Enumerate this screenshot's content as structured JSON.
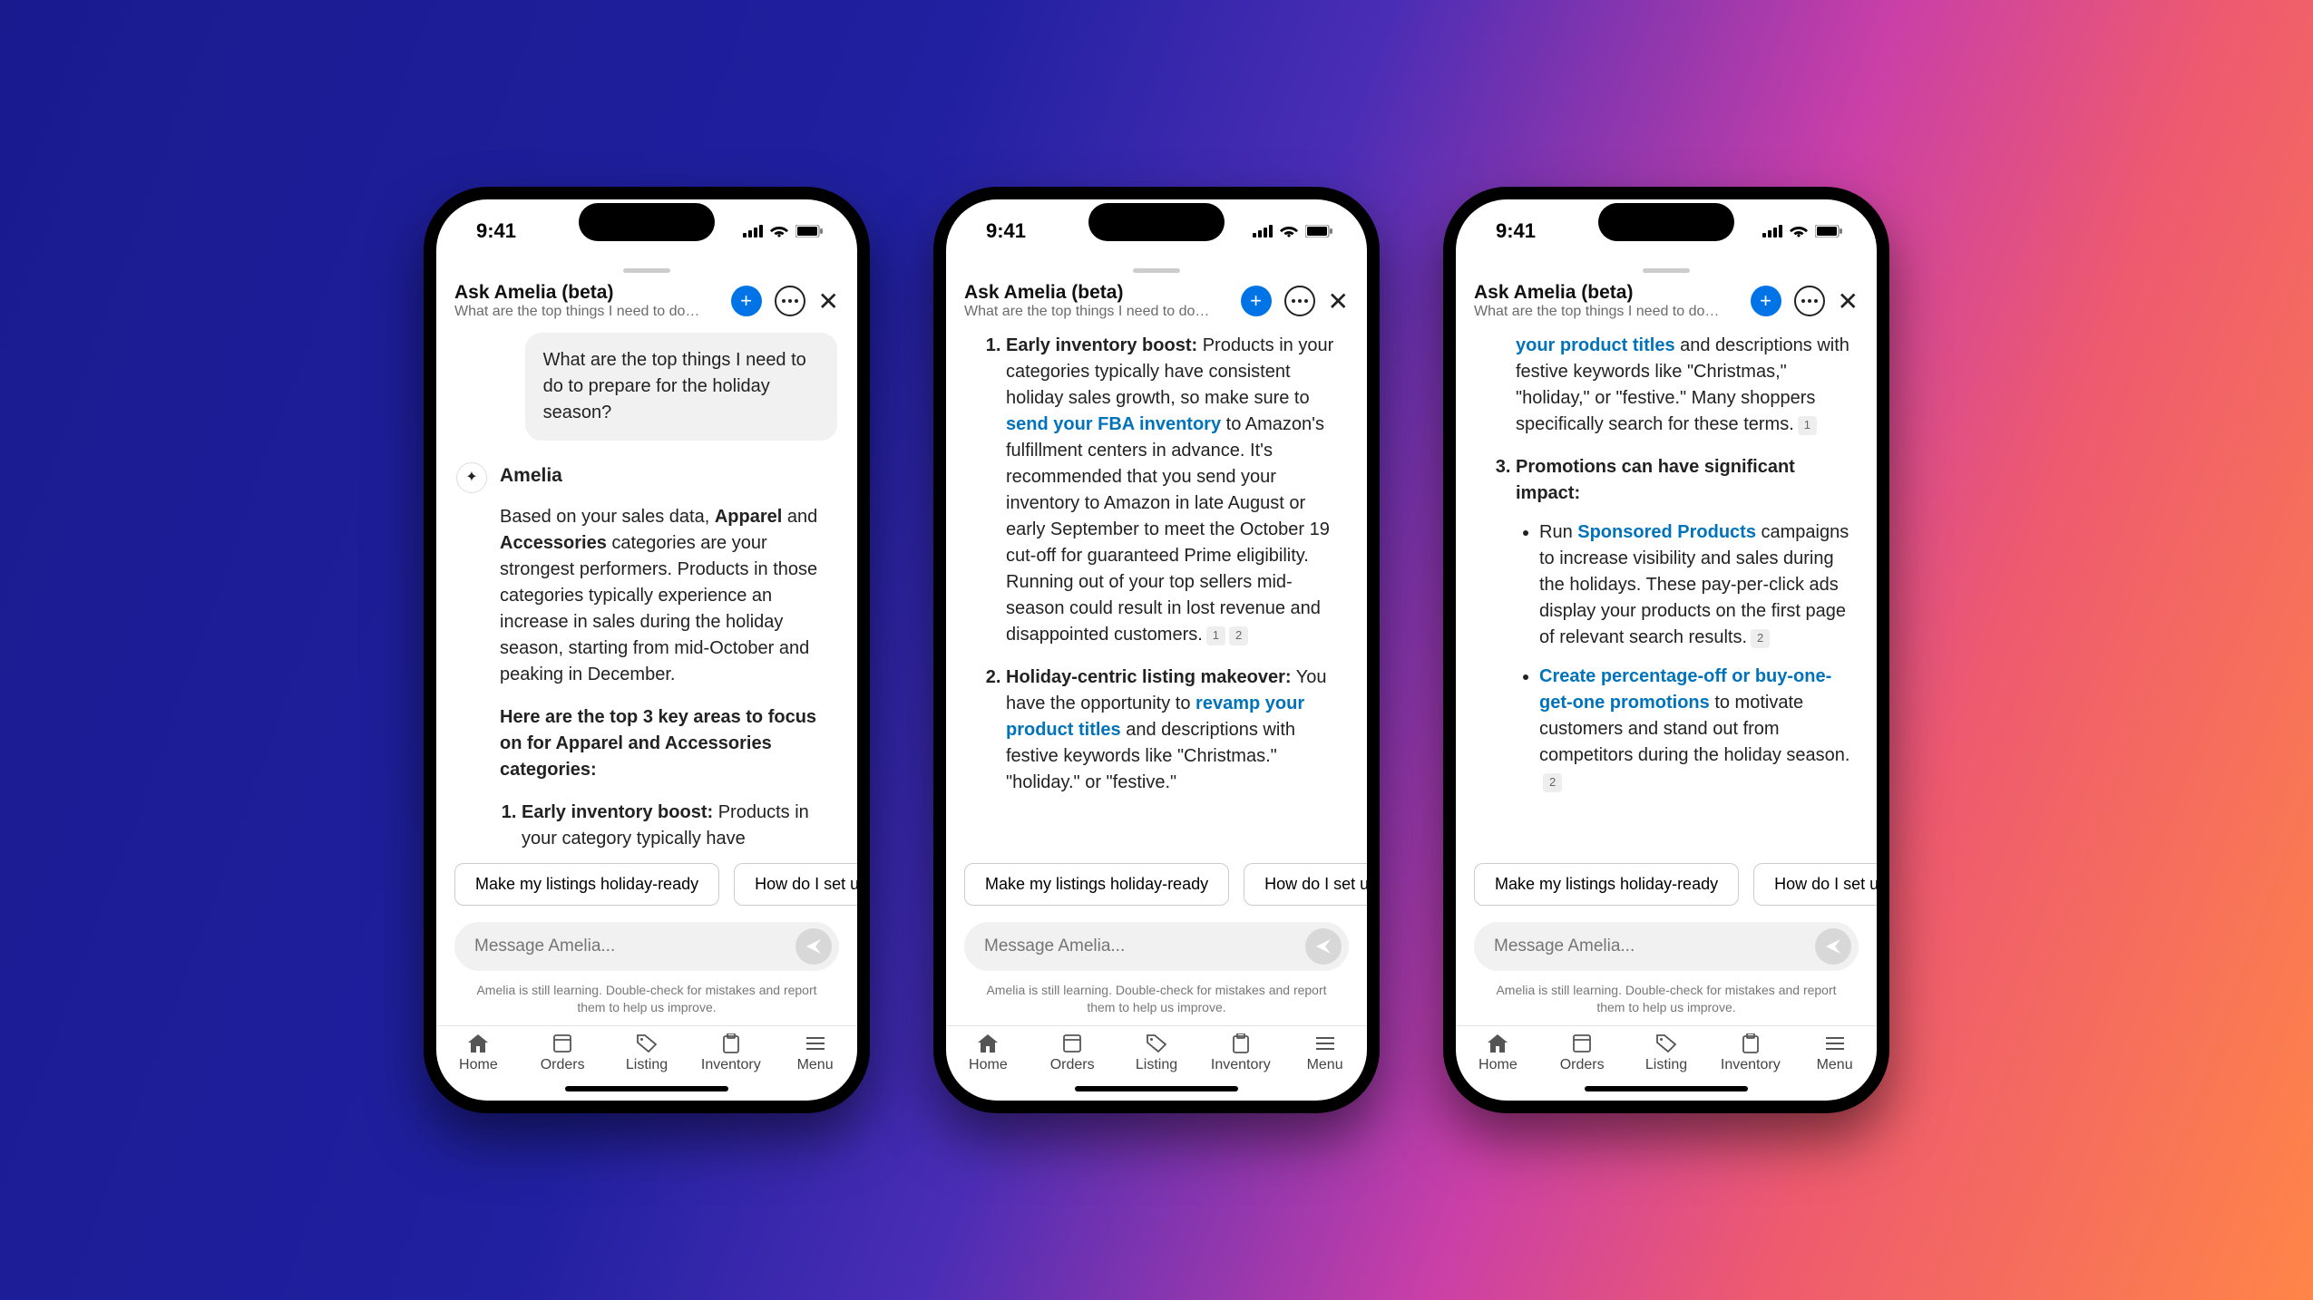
{
  "status": {
    "time": "9:41"
  },
  "header": {
    "title": "Ask Amelia (beta)",
    "subtitle": "What are the top things I need to do…"
  },
  "user_message": "What are the top things I need to do to prepare for the holiday season?",
  "assistant_name": "Amelia",
  "screen1": {
    "p1_a": "Based on your sales data, ",
    "p1_bold": "Apparel",
    "p1_b": " and ",
    "p1_bold2": "Accessories",
    "p1_c": " categories are your strongest performers. Products in those categories typically experience an increase in sales during the holiday season, starting from mid-October and peaking in December.",
    "p2": "Here are the top 3 key areas to focus on for Apparel and Accessories categories:",
    "li1_title": "Early inventory boost:",
    "li1_body": " Products in your category typically have"
  },
  "screen2": {
    "li1_title": "Early inventory boost:",
    "li1_a": " Products in your categories typically have consistent holiday sales growth, so make sure to ",
    "li1_link": "send your FBA inventory",
    "li1_b": " to Amazon's fulfillment centers in advance. It's recommended that you send your inventory to Amazon in late August or early September to meet the October 19 cut-off for guaranteed Prime eligibility. Running out of your top sellers mid-season could result in lost revenue and disappointed customers.",
    "li1_c1": "1",
    "li1_c2": "2",
    "li2_title": "Holiday-centric listing makeover:",
    "li2_a": " You have the opportunity to ",
    "li2_link": "revamp your product titles",
    "li2_b": " and descriptions with festive keywords like \"Christmas.\" \"holiday.\" or \"festive.\""
  },
  "screen3": {
    "cont_link": "your product titles",
    "cont_a": " and descriptions with festive keywords like \"Christmas,\" \"holiday,\" or \"festive.\" Many shoppers specifically search for these terms.",
    "cont_c1": "1",
    "li3_title": "Promotions can have significant impact:",
    "b1_a": "Run ",
    "b1_link": "Sponsored Products",
    "b1_b": " campaigns to increase visibility and sales during the holidays. These pay-per-click ads display your products on the first page of relevant search results.",
    "b1_c1": "2",
    "b2_link": "Create percentage-off or buy-one-get-one promotions",
    "b2_a": " to motivate customers and stand out from competitors during the holiday season.",
    "b2_c1": "2"
  },
  "suggestions": [
    "Make my listings holiday-ready",
    "How do I set up a"
  ],
  "input_placeholder": "Message Amelia...",
  "disclaimer": "Amelia is still learning. Double-check for mistakes and report them to help us improve.",
  "tabs": [
    "Home",
    "Orders",
    "Listing",
    "Inventory",
    "Menu"
  ]
}
